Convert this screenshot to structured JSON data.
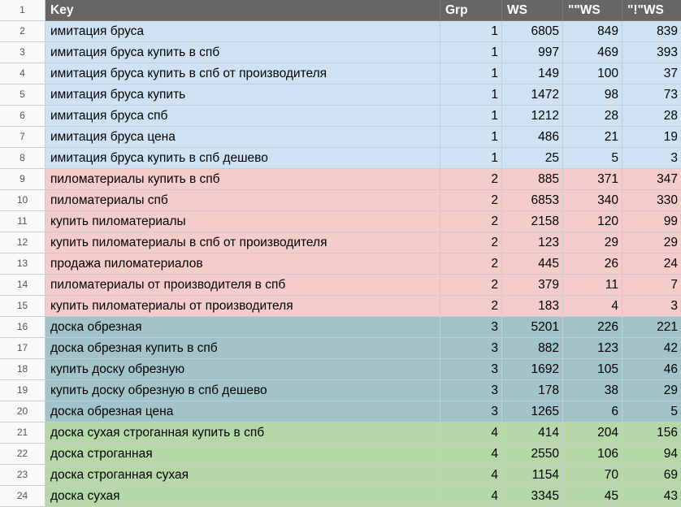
{
  "headers": {
    "row_num": "1",
    "key": "Key",
    "grp": "Grp",
    "ws": "WS",
    "ws_quoted": "\"\"WS",
    "ws_exact": "\"!\"WS"
  },
  "group_colors": {
    "1": "#cfe2f3",
    "2": "#f4cccc",
    "3": "#a2c4c9",
    "4": "#b6d7a8",
    "header": "#666666"
  },
  "rows": [
    {
      "n": "2",
      "key": "имитация бруса",
      "grp": "1",
      "ws": "6805",
      "ws_quoted": "849",
      "ws_exact": "839"
    },
    {
      "n": "3",
      "key": "имитация бруса купить в спб",
      "grp": "1",
      "ws": "997",
      "ws_quoted": "469",
      "ws_exact": "393"
    },
    {
      "n": "4",
      "key": "имитация бруса купить в спб от производителя",
      "grp": "1",
      "ws": "149",
      "ws_quoted": "100",
      "ws_exact": "37"
    },
    {
      "n": "5",
      "key": "имитация бруса купить",
      "grp": "1",
      "ws": "1472",
      "ws_quoted": "98",
      "ws_exact": "73"
    },
    {
      "n": "6",
      "key": "имитация бруса спб",
      "grp": "1",
      "ws": "1212",
      "ws_quoted": "28",
      "ws_exact": "28"
    },
    {
      "n": "7",
      "key": "имитация бруса цена",
      "grp": "1",
      "ws": "486",
      "ws_quoted": "21",
      "ws_exact": "19"
    },
    {
      "n": "8",
      "key": "имитация бруса купить в спб дешево",
      "grp": "1",
      "ws": "25",
      "ws_quoted": "5",
      "ws_exact": "3"
    },
    {
      "n": "9",
      "key": "пиломатериалы купить в спб",
      "grp": "2",
      "ws": "885",
      "ws_quoted": "371",
      "ws_exact": "347"
    },
    {
      "n": "10",
      "key": "пиломатериалы спб",
      "grp": "2",
      "ws": "6853",
      "ws_quoted": "340",
      "ws_exact": "330"
    },
    {
      "n": "11",
      "key": "купить пиломатериалы",
      "grp": "2",
      "ws": "2158",
      "ws_quoted": "120",
      "ws_exact": "99"
    },
    {
      "n": "12",
      "key": "купить пиломатериалы в спб от производителя",
      "grp": "2",
      "ws": "123",
      "ws_quoted": "29",
      "ws_exact": "29"
    },
    {
      "n": "13",
      "key": "продажа пиломатериалов",
      "grp": "2",
      "ws": "445",
      "ws_quoted": "26",
      "ws_exact": "24"
    },
    {
      "n": "14",
      "key": "пиломатериалы от производителя в спб",
      "grp": "2",
      "ws": "379",
      "ws_quoted": "11",
      "ws_exact": "7"
    },
    {
      "n": "15",
      "key": "купить пиломатериалы от производителя",
      "grp": "2",
      "ws": "183",
      "ws_quoted": "4",
      "ws_exact": "3"
    },
    {
      "n": "16",
      "key": "доска обрезная",
      "grp": "3",
      "ws": "5201",
      "ws_quoted": "226",
      "ws_exact": "221"
    },
    {
      "n": "17",
      "key": "доска обрезная купить в спб",
      "grp": "3",
      "ws": "882",
      "ws_quoted": "123",
      "ws_exact": "42"
    },
    {
      "n": "18",
      "key": "купить доску обрезную",
      "grp": "3",
      "ws": "1692",
      "ws_quoted": "105",
      "ws_exact": "46"
    },
    {
      "n": "19",
      "key": "купить доску обрезную в спб дешево",
      "grp": "3",
      "ws": "178",
      "ws_quoted": "38",
      "ws_exact": "29"
    },
    {
      "n": "20",
      "key": "доска обрезная цена",
      "grp": "3",
      "ws": "1265",
      "ws_quoted": "6",
      "ws_exact": "5"
    },
    {
      "n": "21",
      "key": "доска сухая строганная купить в спб",
      "grp": "4",
      "ws": "414",
      "ws_quoted": "204",
      "ws_exact": "156"
    },
    {
      "n": "22",
      "key": "доска строганная",
      "grp": "4",
      "ws": "2550",
      "ws_quoted": "106",
      "ws_exact": "94"
    },
    {
      "n": "23",
      "key": "доска строганная сухая",
      "grp": "4",
      "ws": "1154",
      "ws_quoted": "70",
      "ws_exact": "69"
    },
    {
      "n": "24",
      "key": "доска сухая",
      "grp": "4",
      "ws": "3345",
      "ws_quoted": "45",
      "ws_exact": "43"
    }
  ]
}
